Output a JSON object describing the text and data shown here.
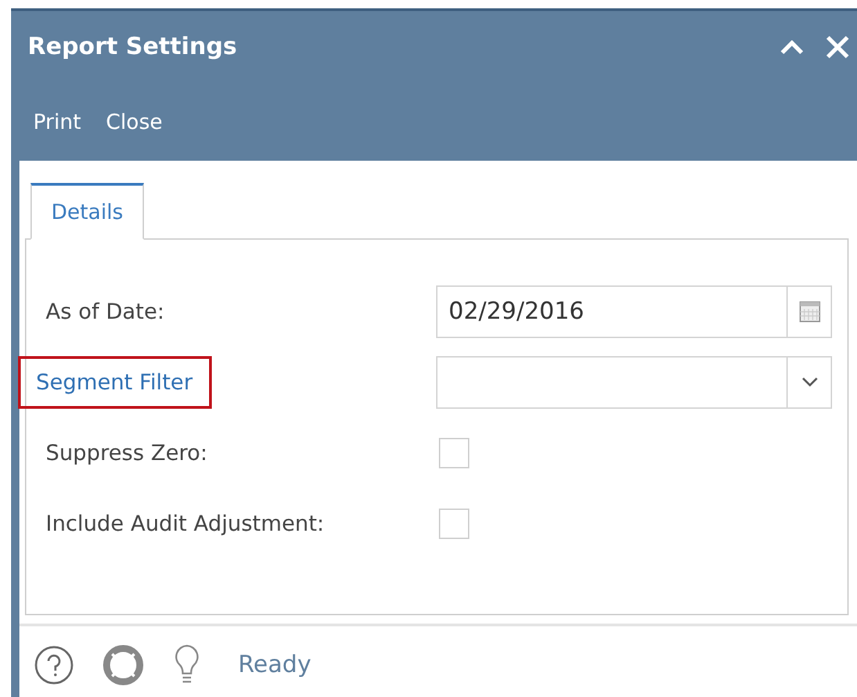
{
  "window": {
    "title": "Report Settings"
  },
  "toolbar": [
    "Print",
    "Close"
  ],
  "tabs": [
    {
      "label": "Details",
      "selected": true
    }
  ],
  "fields": [
    {
      "kind": "date",
      "label": "As of Date:",
      "value": "02/29/2016",
      "link": false,
      "highlighted": false
    },
    {
      "kind": "select",
      "label": "Segment Filter",
      "link": true,
      "highlighted": true
    },
    {
      "kind": "checkbox",
      "label": "Suppress Zero:",
      "checked": false,
      "link": false,
      "highlighted": false
    },
    {
      "kind": "checkbox",
      "label": "Include Audit Adjustment:",
      "checked": false,
      "link": false,
      "highlighted": false
    }
  ],
  "status_bar": {
    "status": "Ready"
  }
}
